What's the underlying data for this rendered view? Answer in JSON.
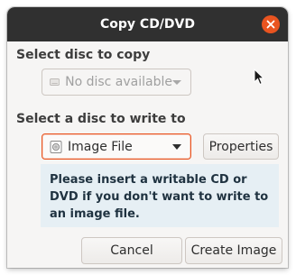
{
  "window": {
    "title": "Copy CD/DVD",
    "close_icon": "close-icon"
  },
  "source": {
    "label": "Select disc to copy",
    "selected": "No disc available",
    "icon": "disc-drive-icon"
  },
  "destination": {
    "label": "Select a disc to write to",
    "selected": "Image File",
    "icon": "disc-image-icon",
    "properties_label": "Properties"
  },
  "info_message": "Please insert a writable CD or DVD if you don't want to write to an image file.",
  "actions": {
    "cancel_label": "Cancel",
    "create_label": "Create Image"
  },
  "colors": {
    "accent": "#e95420",
    "titlebar": "#303030",
    "info_bg": "#e6eff4"
  }
}
